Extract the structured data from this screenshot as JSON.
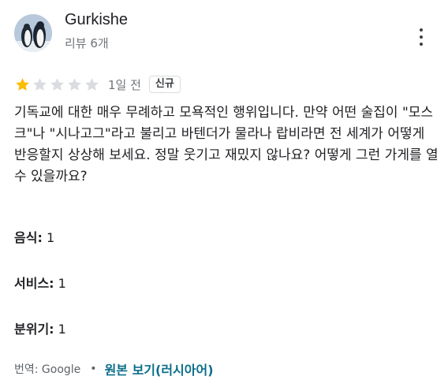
{
  "reviewer": {
    "name": "Gurkishe",
    "meta": "리뷰 6개"
  },
  "rating": {
    "stars": 1,
    "max_stars": 5,
    "date": "1일 전",
    "badge": "신규"
  },
  "review": {
    "text": "기독교에 대한 매우 무례하고 모욕적인 행위입니다. 만약 어떤 술집이 \"모스크\"나 \"시나고그\"라고 불리고 바텐더가 물라나 랍비라면 전 세계가 어떻게 반응할지 상상해 보세요. 정말 웃기고 재밌지 않나요? 어떻게 그런 가게를 열 수 있을까요?"
  },
  "aspects": [
    {
      "label": "음식:",
      "value": "1"
    },
    {
      "label": "서비스:",
      "value": "1"
    },
    {
      "label": "분위기:",
      "value": "1"
    }
  ],
  "translation": {
    "label": "번역: Google",
    "separator": "•",
    "link": "원본 보기(러시아어)"
  },
  "colors": {
    "star_filled": "#fbbc04",
    "star_empty": "#dadce0",
    "link": "#0b6e8a"
  }
}
